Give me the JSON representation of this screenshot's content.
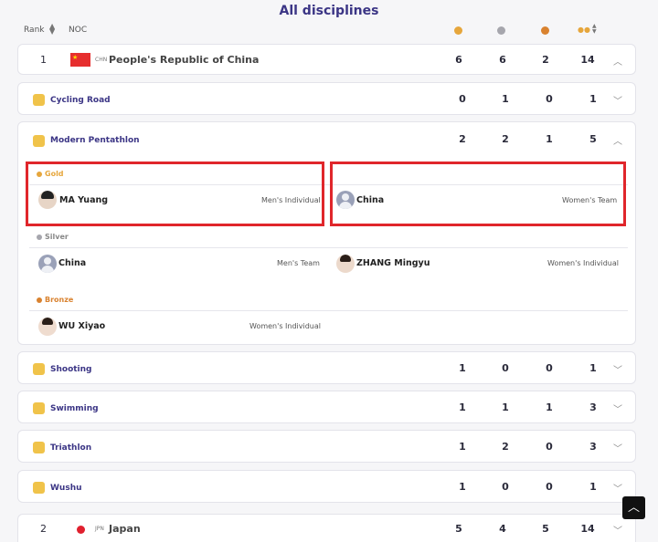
{
  "title": "All disciplines",
  "header": {
    "rank": "Rank",
    "noc": "NOC"
  },
  "medal_colors": {
    "gold": "#e6a63c",
    "silver": "#a6a6ad",
    "bronze": "#d9822f",
    "total": "#e6b47c"
  },
  "countries": [
    {
      "rank": "1",
      "code": "CHN",
      "name": "People's Republic of China",
      "gold": "6",
      "silver": "6",
      "bronze": "2",
      "total": "14"
    },
    {
      "rank": "2",
      "code": "JPN",
      "name": "Japan",
      "gold": "5",
      "silver": "4",
      "bronze": "5",
      "total": "14"
    }
  ],
  "disciplines": [
    {
      "name": "Cycling Road",
      "gold": "0",
      "silver": "1",
      "bronze": "0",
      "total": "1"
    },
    {
      "name": "Modern Pentathlon",
      "gold": "2",
      "silver": "2",
      "bronze": "1",
      "total": "5"
    },
    {
      "name": "Shooting",
      "gold": "1",
      "silver": "0",
      "bronze": "0",
      "total": "1"
    },
    {
      "name": "Swimming",
      "gold": "1",
      "silver": "1",
      "bronze": "1",
      "total": "3"
    },
    {
      "name": "Triathlon",
      "gold": "1",
      "silver": "2",
      "bronze": "0",
      "total": "3"
    },
    {
      "name": "Wushu",
      "gold": "1",
      "silver": "0",
      "bronze": "0",
      "total": "1"
    }
  ],
  "pentathlon": {
    "gold_label": "Gold",
    "silver_label": "Silver",
    "bronze_label": "Bronze",
    "gold": [
      {
        "athlete": "MA Yuang",
        "event": "Men's Individual"
      },
      {
        "athlete": "China",
        "event": "Women's Team"
      }
    ],
    "silver": [
      {
        "athlete": "China",
        "event": "Men's Team"
      },
      {
        "athlete": "ZHANG Mingyu",
        "event": "Women's Individual"
      }
    ],
    "bronze": [
      {
        "athlete": "WU Xiyao",
        "event": "Women's Individual"
      }
    ]
  }
}
